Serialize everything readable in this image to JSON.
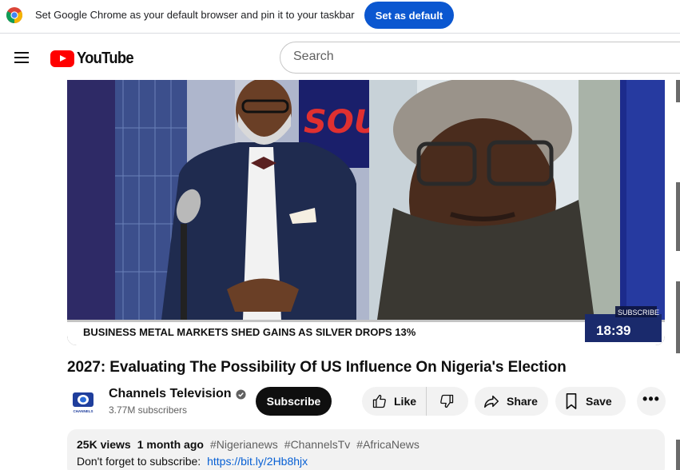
{
  "banner": {
    "message": "Set Google Chrome as your default browser and pin it to your taskbar",
    "button_label": "Set as default",
    "icon": "chrome-icon"
  },
  "header": {
    "logo_text": "YouTube",
    "search_placeholder": "Search",
    "menu_icon": "hamburger-menu-icon"
  },
  "player": {
    "ticker_text": "BUSINESS  METAL MARKETS SHED GAINS AS SILVER DROPS 13%",
    "clock": "18:39",
    "overlay_label": "SUBSCRIBE",
    "backdrop_text": "SOU"
  },
  "video": {
    "title": "2027: Evaluating The Possibility Of US Influence On Nigeria's Election"
  },
  "channel": {
    "name": "Channels Television",
    "subscribers": "3.77M subscribers",
    "avatar_label": "CHANNELS",
    "subscribe_label": "Subscribe"
  },
  "actions": {
    "like_label": "Like",
    "share_label": "Share",
    "save_label": "Save",
    "more_label": "•••"
  },
  "description": {
    "views": "25K views",
    "age": "1 month ago",
    "tags": [
      "#Nigerianews",
      "#ChannelsTv",
      "#AfricaNews"
    ],
    "subscribe_prompt": "Don't forget to subscribe:",
    "link": "https://bit.ly/2Hb8hjx"
  },
  "colors": {
    "brand_red": "#ff0000",
    "chrome_blue": "#0b57d0",
    "link_blue": "#065fd4",
    "ticker_bg": "#ffffff",
    "clock_bg": "#1a2a6c"
  }
}
